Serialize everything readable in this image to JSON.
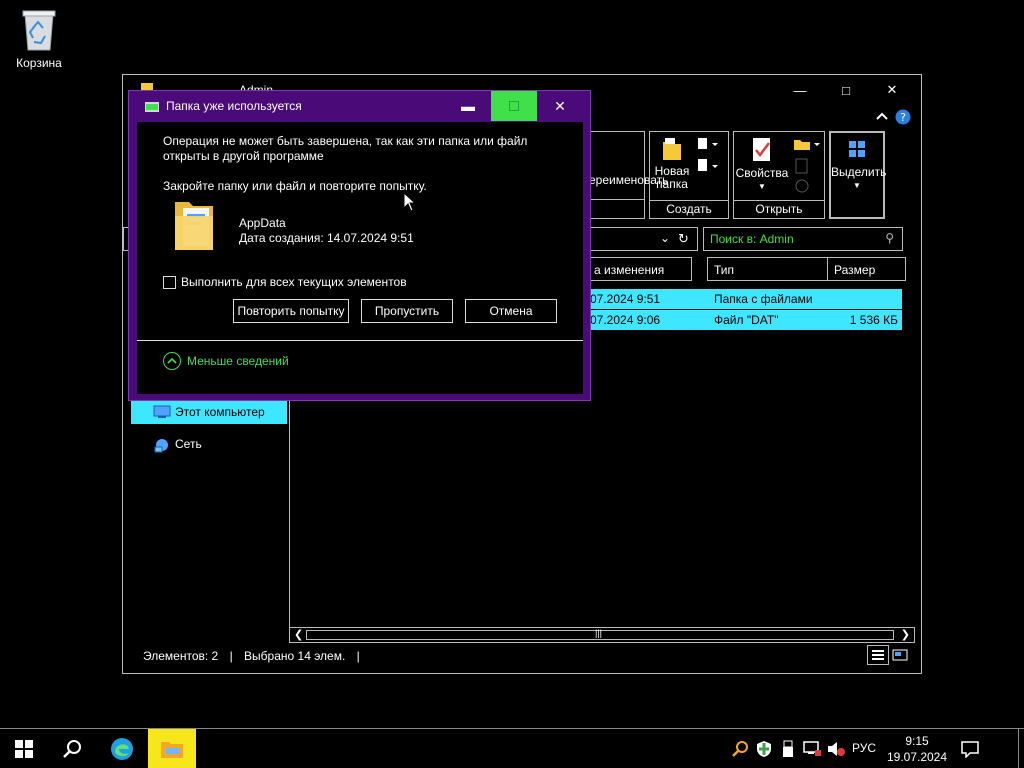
{
  "desktop": {
    "recycle_bin_label": "Корзина"
  },
  "explorer": {
    "title": "Admin",
    "ribbon": {
      "rename_label": "ереименовать",
      "new_folder_label_1": "Новая",
      "new_folder_label_2": "папка",
      "properties_label": "Свойства",
      "select_label": "Выделить",
      "groups": {
        "create": "Создать",
        "open": "Открыть"
      }
    },
    "search_placeholder": "Поиск в: Admin",
    "columns": {
      "modified": "а изменения",
      "type": "Тип",
      "size": "Размер"
    },
    "files": [
      {
        "modified": "07.2024 9:51",
        "type": "Папка с файлами",
        "size": ""
      },
      {
        "modified": "07.2024 9:06",
        "type": "Файл \"DAT\"",
        "size": "1 536 КБ"
      }
    ],
    "nav": {
      "this_pc": "Этот компьютер",
      "network": "Сеть"
    },
    "status": {
      "items": "Элементов: 2",
      "selected": "Выбрано 14 элем."
    }
  },
  "dialog": {
    "title": "Папка уже используется",
    "message_line1": "Операция не может быть завершена, так как эти папка или файл",
    "message_line2": "открыты в другой программе",
    "hint": "Закройте папку или файл и повторите попытку.",
    "file_name": "AppData",
    "file_created": "Дата создания: 14.07.2024 9:51",
    "apply_all_label": "Выполнить для всех текущих элементов",
    "retry_label": "Повторить попытку",
    "skip_label": "Пропустить",
    "cancel_label": "Отмена",
    "less_details_label": "Меньше сведений"
  },
  "taskbar": {
    "language": "РУС",
    "time": "9:15",
    "date": "19.07.2024"
  },
  "colors": {
    "selection": "#3fe6ff",
    "accent_green": "#3fe04a",
    "dialog_frame": "#4a0b78",
    "active_app": "#f7e71a"
  }
}
